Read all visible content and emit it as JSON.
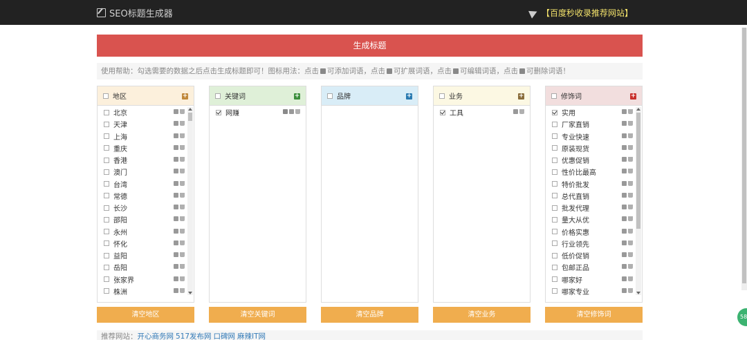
{
  "topbar": {
    "brand": "SEO标题生成器",
    "promo": "【百度秒收录推荐网站】"
  },
  "generate_label": "生成标题",
  "help": {
    "p1": "使用帮助：勾选需要的数据之后点击生成标题即可！图标用法：点击",
    "p2": "可添加词语，点击",
    "p3": "可扩展词语，点击",
    "p4": "可编辑词语，点击",
    "p5": "可删除词语！"
  },
  "panels": [
    {
      "title": "地区",
      "head_bg": "#fcf0dc",
      "add_color": "#c0883a",
      "clear": "清空地区",
      "items": [
        "北京",
        "天津",
        "上海",
        "重庆",
        "香港",
        "澳门",
        "台湾",
        "常德",
        "长沙",
        "邵阳",
        "永州",
        "怀化",
        "益阳",
        "岳阳",
        "张家界",
        "株洲"
      ]
    },
    {
      "title": "关键词",
      "head_bg": "#dff0d8",
      "add_color": "#3c8f3c",
      "clear": "清空关键词",
      "items": [
        "网赚"
      ]
    },
    {
      "title": "品牌",
      "head_bg": "#d9edf7",
      "add_color": "#2a7ab0",
      "clear": "清空品牌",
      "items": []
    },
    {
      "title": "业务",
      "head_bg": "#fcf8e3",
      "add_color": "#8a6d3b",
      "clear": "清空业务",
      "items": [
        "工具"
      ]
    },
    {
      "title": "修饰词",
      "head_bg": "#f2dede",
      "add_color": "#c9302c",
      "clear": "清空修饰词",
      "items": [
        "实用",
        "厂家直销",
        "专业快速",
        "原装现货",
        "优惠促销",
        "性价比最高",
        "特价批发",
        "总代直销",
        "批发代理",
        "量大从优",
        "价格实惠",
        "行业领先",
        "低价促销",
        "包邮正品",
        "哪家好",
        "哪家专业"
      ]
    }
  ],
  "checked": {
    "1": [
      0
    ],
    "3": [
      0
    ],
    "4": [
      0
    ]
  },
  "recommend": {
    "label": "推荐网站：",
    "links": [
      "开心商务网",
      "517发布网",
      "口碑网",
      "麻辣IT网"
    ]
  },
  "widget_text": "58"
}
